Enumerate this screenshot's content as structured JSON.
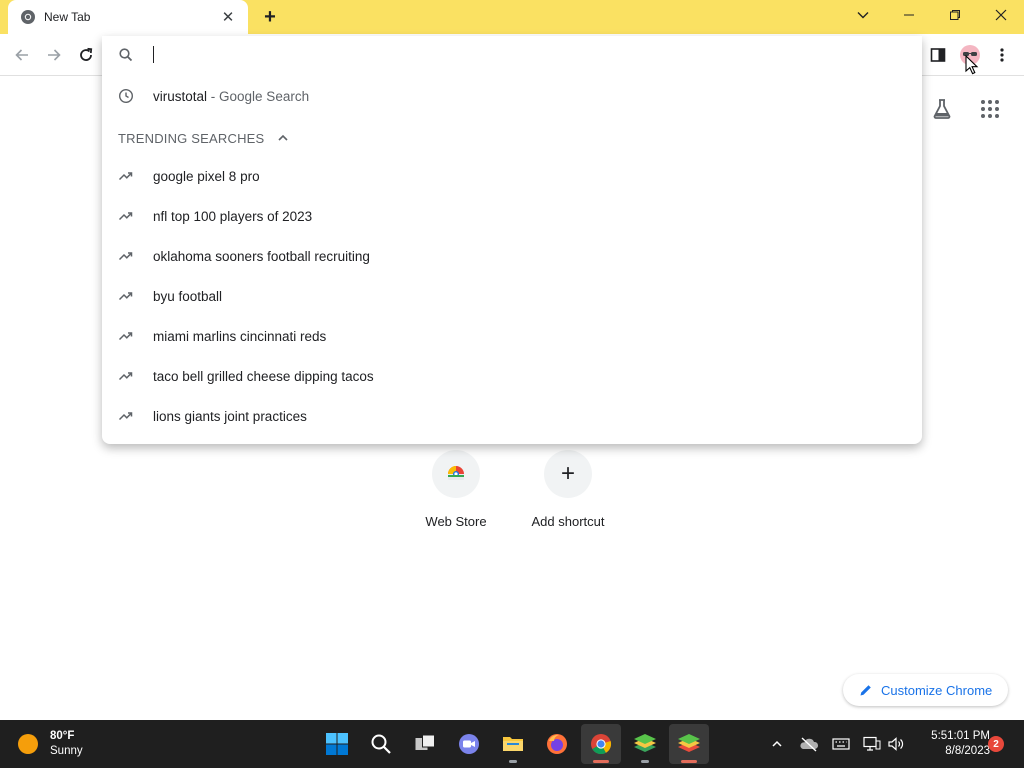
{
  "tab": {
    "title": "New Tab",
    "close_glyph": "✕"
  },
  "newtab": {
    "glyph": "+"
  },
  "window_controls": {
    "dropdown": "chevron-down-icon",
    "minimize": "minimize-icon",
    "maximize": "restore-icon",
    "close": "close-icon"
  },
  "omnibox": {
    "value": "",
    "history": {
      "query": "virustotal",
      "suffix": " - Google Search"
    },
    "trending_header": "TRENDING SEARCHES",
    "trending": [
      "google pixel 8 pro",
      "nfl top 100 players of 2023",
      "oklahoma sooners football recruiting",
      "byu football",
      "miami marlins cincinnati reds",
      "taco bell grilled cheese dipping tacos",
      "lions giants joint practices"
    ]
  },
  "shortcuts": [
    {
      "label": "Web Store",
      "icon": "web-store-icon"
    },
    {
      "label": "Add shortcut",
      "glyph": "+"
    }
  ],
  "customize": {
    "label": "Customize Chrome"
  },
  "taskbar": {
    "weather": {
      "temp": "80°F",
      "condition": "Sunny"
    },
    "clock": {
      "time": "5:51:01 PM",
      "date": "8/8/2023"
    },
    "notifications": "2"
  },
  "colors": {
    "tabstrip": "#fae162",
    "taskbar": "#1f1f1f",
    "accent": "#1a73e8"
  }
}
